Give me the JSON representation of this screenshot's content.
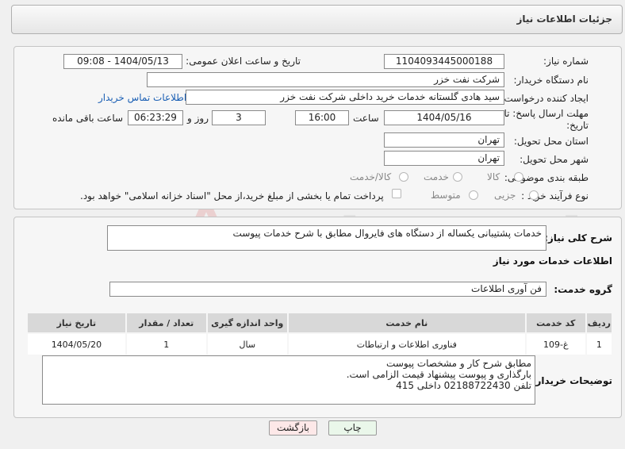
{
  "header": {
    "title": "جزئیات اطلاعات نیاز"
  },
  "need_number": {
    "label": "شماره نیاز:",
    "value": "1104093445000188"
  },
  "announce_datetime": {
    "label": "تاریخ و ساعت اعلان عمومی:",
    "value": "1404/05/13 - 09:08"
  },
  "buyer_org": {
    "label": "نام دستگاه خریدار:",
    "value": "شرکت نفت خزر"
  },
  "requester": {
    "label": "ایجاد کننده درخواست:",
    "value": "سید هادی گلستانه خدمات خرید داخلی شرکت نفت خزر",
    "link": "اطلاعات تماس خریدار"
  },
  "deadline": {
    "label_line1": "مهلت ارسال پاسخ: تا",
    "label_line2": "تاریخ:",
    "date": "1404/05/16",
    "time_label": "ساعت",
    "time": "16:00",
    "days": "3",
    "days_label": "روز و",
    "remaining": "06:23:29",
    "remaining_label": "ساعت باقی مانده"
  },
  "province": {
    "label": "استان محل تحویل:",
    "value": "تهران"
  },
  "city": {
    "label": "شهر محل تحویل:",
    "value": "تهران"
  },
  "category": {
    "label": "طبقه بندی موضوعی:",
    "options": [
      "کالا",
      "خدمت",
      "کالا/خدمت"
    ]
  },
  "process": {
    "label": "نوع فرآیند خرید :",
    "options": [
      "جزیی",
      "متوسط"
    ],
    "payment_note": "پرداخت تمام یا بخشی از مبلغ خرید،از محل \"اسناد خزانه اسلامی\" خواهد بود."
  },
  "description": {
    "label": "شرح کلی نیاز:",
    "value": "خدمات پشتیبانی یکساله از دستگاه های فایروال مطابق با شرح خدمات پیوست"
  },
  "services_title": "اطلاعات خدمات مورد نیاز",
  "service_group": {
    "label": "گروه خدمت:",
    "value": "فن آوری اطلاعات"
  },
  "table": {
    "headers": [
      "ردیف",
      "کد خدمت",
      "نام خدمت",
      "واحد اندازه گیری",
      "تعداد / مقدار",
      "تاریخ نیاز"
    ],
    "rows": [
      [
        "1",
        "غ-109",
        "فناوری اطلاعات و ارتباطات",
        "سال",
        "1",
        "1404/05/20"
      ]
    ]
  },
  "buyer_notes": {
    "label": "توضیحات خریدار:",
    "lines": [
      "مطابق شرح کار و مشخصات پیوست",
      "بارگذاری و پیوست پیشنهاد قیمت الزامی است.",
      "تلفن 02188722430 داخلی 415"
    ]
  },
  "buttons": {
    "print": "چاپ",
    "back": "بازگشت"
  },
  "watermark": {
    "text": "AriaTender.neT"
  },
  "colors": {
    "link": "#1a5fb4",
    "back_button_bg": "#fde8e8",
    "print_button_bg": "#eaf7ea"
  }
}
